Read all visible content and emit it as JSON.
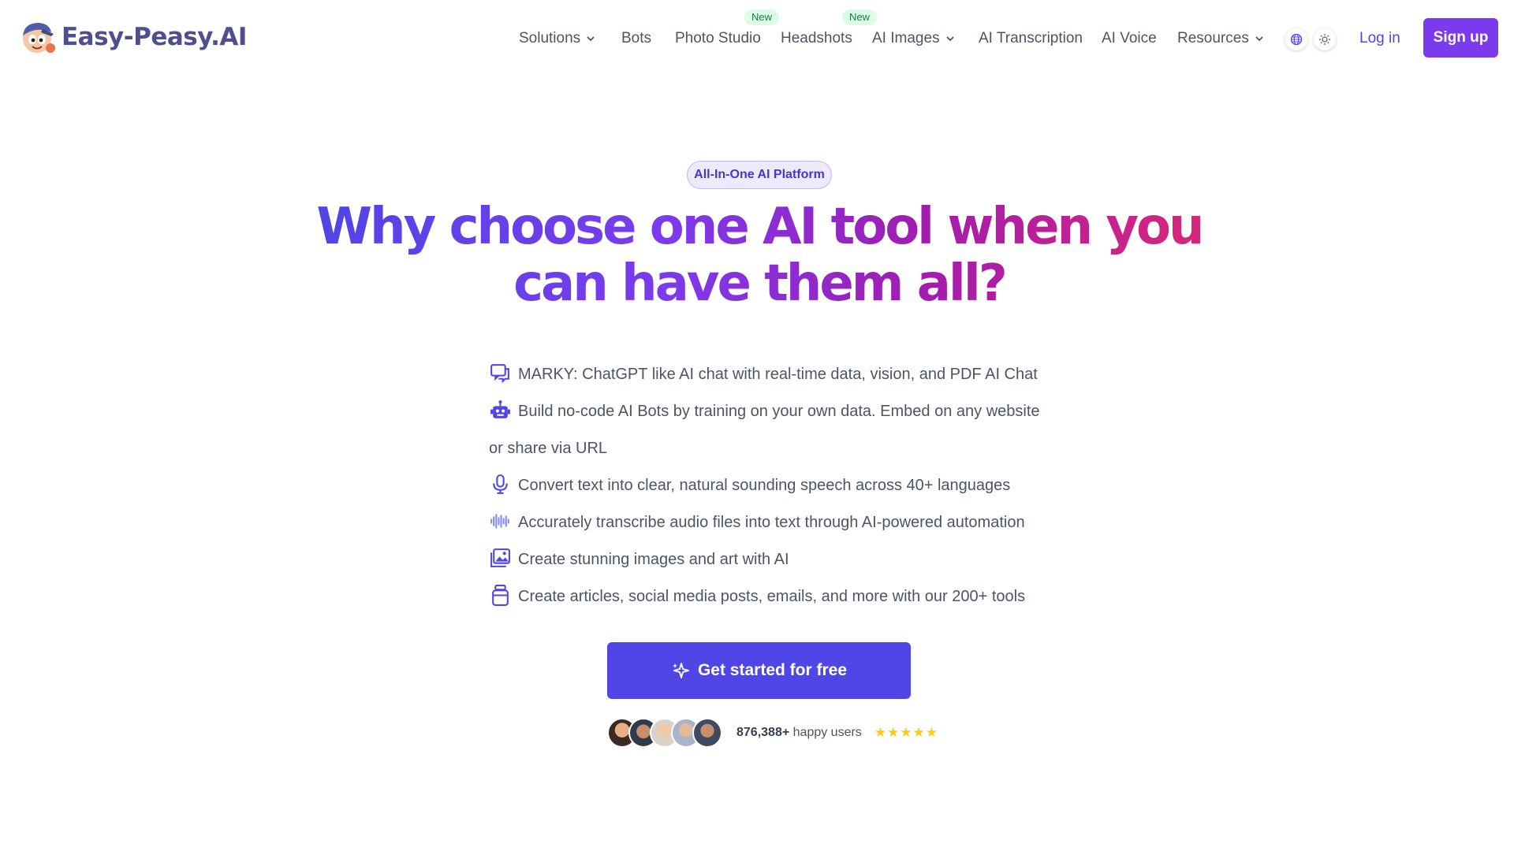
{
  "brand": {
    "name": "Easy-Peasy.AI"
  },
  "nav": {
    "items": [
      {
        "label": "Solutions",
        "dropdown": true
      },
      {
        "label": "Bots"
      },
      {
        "label": "Photo Studio",
        "badge": "New"
      },
      {
        "label": "Headshots",
        "badge": "New"
      },
      {
        "label": "AI Images",
        "dropdown": true
      },
      {
        "label": "AI Transcription"
      },
      {
        "label": "AI Voice"
      },
      {
        "label": "Resources",
        "dropdown": true
      }
    ],
    "icons": [
      "globe-icon",
      "sun-icon"
    ],
    "login": "Log in",
    "signup": "Sign up"
  },
  "hero": {
    "badge": "All-In-One AI Platform",
    "headline": "Why choose one AI tool when you can have them all?",
    "features": [
      {
        "icon": "chat-icon",
        "text": "MARKY: ChatGPT like AI chat with real-time data, vision, and PDF AI Chat"
      },
      {
        "icon": "robot-icon",
        "text": "Build no-code AI Bots by training on your own data. Embed on any website or share via URL"
      },
      {
        "icon": "microphone-icon",
        "text": "Convert text into clear, natural sounding speech across 40+ languages"
      },
      {
        "icon": "waveform-icon",
        "text": "Accurately transcribe audio files into text through AI-powered automation"
      },
      {
        "icon": "images-icon",
        "text": "Create stunning images and art with AI"
      },
      {
        "icon": "jar-icon",
        "text": "Create articles, social media posts, emails, and more with our 200+ tools"
      }
    ],
    "cta": "Get started for free",
    "user_count": "876,388+",
    "users_label": "happy users",
    "rating_stars": 5,
    "stars_text": "★★★★★"
  },
  "colors": {
    "primary": "#4f46e5",
    "signup_bg": "#7c3aed",
    "headline_gradient": [
      "#4f46e5",
      "#7c3aed",
      "#a21caf",
      "#db2777"
    ],
    "new_badge_bg": "#dcfce7",
    "new_badge_text": "#15803d",
    "stars": "#facc15"
  }
}
